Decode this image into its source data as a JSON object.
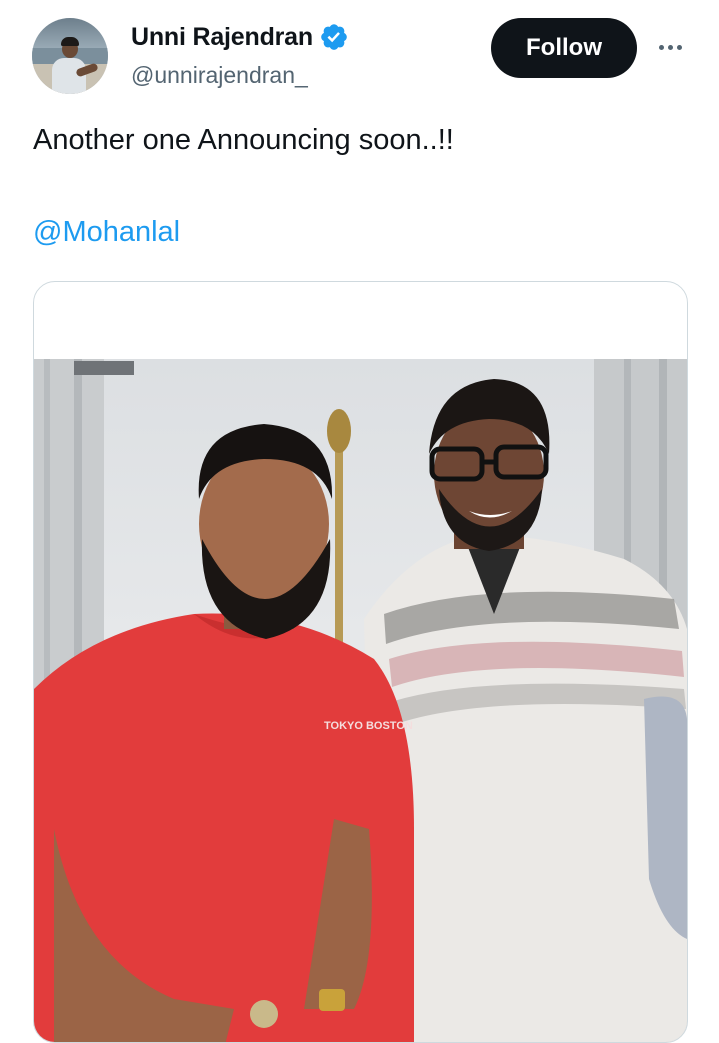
{
  "author": {
    "name": "Unni Rajendran",
    "handle": "@unnirajendran_",
    "verified": true,
    "avatar_icon": "profile-photo"
  },
  "actions": {
    "follow_label": "Follow",
    "more_icon": "more-dots-icon"
  },
  "tweet": {
    "text": "Another one Announcing soon..!!",
    "mention": "@Mohanlal"
  },
  "media": {
    "type": "photo",
    "print_text": "TOKYO BOSTON"
  },
  "colors": {
    "link": "#1d9bf0",
    "verified": "#1d9bf0",
    "follow_bg": "#0f1419",
    "secondary_text": "#536471",
    "border": "#cfd9de"
  }
}
